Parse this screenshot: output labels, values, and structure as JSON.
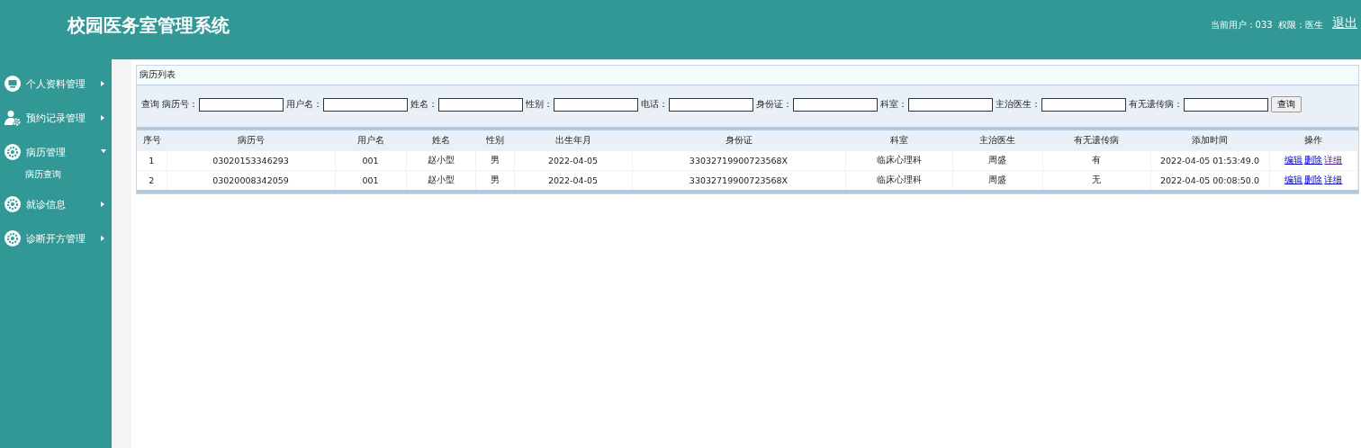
{
  "header": {
    "title": "校园医务室管理系统",
    "user_info": "当前用户：033  权限：医生",
    "logout": "退出"
  },
  "sidebar": {
    "items": [
      {
        "label": "个人资料管理",
        "kind": "monitor",
        "expanded": false
      },
      {
        "label": "预约记录管理",
        "kind": "user",
        "expanded": false
      },
      {
        "label": "病历管理",
        "kind": "gear",
        "expanded": true,
        "children": [
          {
            "label": "病历查询"
          }
        ]
      },
      {
        "label": "就诊信息",
        "kind": "gear",
        "expanded": false
      },
      {
        "label": "诊断开方管理",
        "kind": "gear",
        "expanded": false
      }
    ]
  },
  "panel": {
    "title": "病历列表",
    "search": {
      "prefix": "查询",
      "fields": [
        {
          "label": "病历号："
        },
        {
          "label": "用户名："
        },
        {
          "label": "姓名："
        },
        {
          "label": "性别："
        },
        {
          "label": "电话："
        },
        {
          "label": "身份证："
        },
        {
          "label": "科室："
        },
        {
          "label": "主治医生："
        },
        {
          "label": "有无遗传病："
        }
      ],
      "button": "查询"
    },
    "table": {
      "columns": [
        "序号",
        "病历号",
        "用户名",
        "姓名",
        "性别",
        "出生年月",
        "身份证",
        "科室",
        "主治医生",
        "有无遗传病",
        "添加时间",
        "操作"
      ],
      "rows": [
        {
          "cells": [
            "1",
            "03020153346293",
            "001",
            "赵小型",
            "男",
            "2022-04-05",
            "33032719900723568X",
            "临床心理科",
            "周盛",
            "有",
            "2022-04-05 01:53:49.0"
          ],
          "actions": [
            {
              "label": "编辑",
              "visited": false
            },
            {
              "label": "删除",
              "visited": false
            },
            {
              "label": "详细",
              "visited": true
            }
          ]
        },
        {
          "cells": [
            "2",
            "03020008342059",
            "001",
            "赵小型",
            "男",
            "2022-04-05",
            "33032719900723568X",
            "临床心理科",
            "周盛",
            "无",
            "2022-04-05 00:08:50.0"
          ],
          "actions": [
            {
              "label": "编辑",
              "visited": false
            },
            {
              "label": "删除",
              "visited": false
            },
            {
              "label": "详细",
              "visited": false
            }
          ]
        }
      ]
    }
  }
}
